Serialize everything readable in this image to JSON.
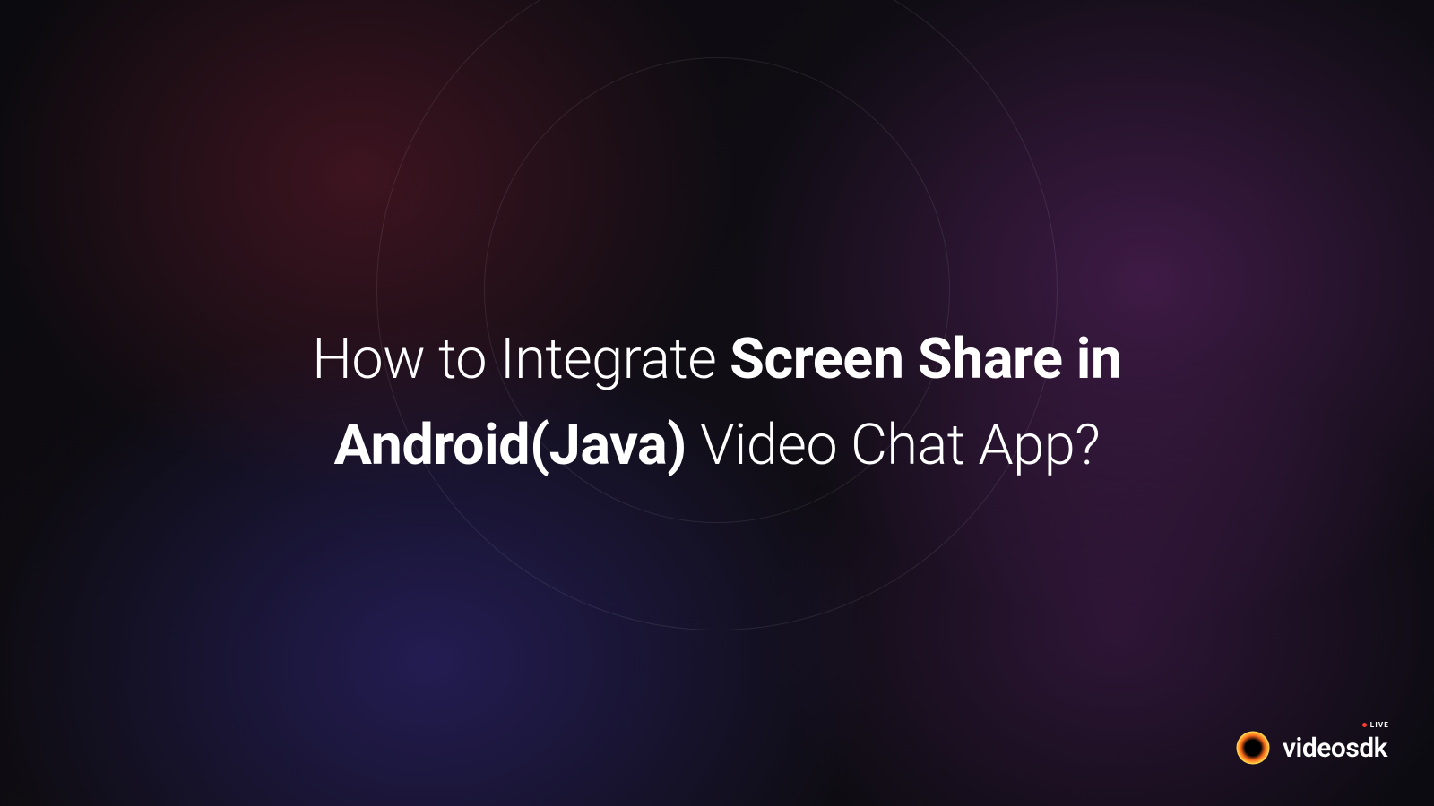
{
  "title": {
    "segments": [
      {
        "text": "How to Integrate ",
        "bold": false
      },
      {
        "text": "Screen Share in Android(Java)",
        "bold": true
      },
      {
        "text": " Video Chat App?",
        "bold": false
      }
    ]
  },
  "logo": {
    "brand": "videosdk",
    "badge": "LIVE",
    "icon_name": "videosdk-logo-icon"
  },
  "colors": {
    "background_base": "#0a0a0f",
    "glow_red": "rgba(120,30,50,0.45)",
    "glow_purple": "rgba(110,40,120,0.50)",
    "glow_blue": "rgba(55,45,150,0.48)",
    "text": "#ffffff",
    "live_dot": "#ff3b30"
  }
}
